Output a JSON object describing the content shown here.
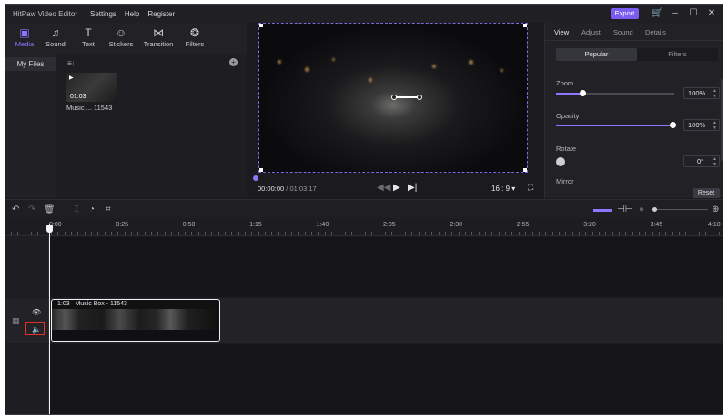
{
  "titlebar": {
    "app_name": "HitPaw Video Editor",
    "menus": [
      "Settings",
      "Help",
      "Register"
    ],
    "export_label": "Export"
  },
  "toolbar": {
    "tools": [
      {
        "label": "Media",
        "icon": "media-icon",
        "active": true
      },
      {
        "label": "Sound",
        "icon": "music-note-icon"
      },
      {
        "label": "Text",
        "icon": "text-icon"
      },
      {
        "label": "Stickers",
        "icon": "sticker-icon"
      },
      {
        "label": "Transition",
        "icon": "transition-icon"
      },
      {
        "label": "Filters",
        "icon": "filters-icon"
      }
    ]
  },
  "media": {
    "nav_item": "My Files",
    "item": {
      "duration": "01:03",
      "name": "Music ... 11543"
    }
  },
  "preview": {
    "current_time": "00:00:00",
    "separator": " / ",
    "total_time": "01:03:17",
    "aspect_ratio": "16 : 9"
  },
  "properties": {
    "tabs": [
      "View",
      "Adjust",
      "Sound",
      "Details"
    ],
    "segments": [
      "Popular",
      "Filters"
    ],
    "zoom": {
      "label": "Zoom",
      "value": "100%",
      "level": 0.22
    },
    "opacity": {
      "label": "Opacity",
      "value": "100%",
      "level": 1.0
    },
    "rotate": {
      "label": "Rotate",
      "value": "0°"
    },
    "mirror": {
      "label": "Mirror"
    },
    "reset_label": "Reset"
  },
  "timeline": {
    "ticks": [
      "0:00",
      "0:25",
      "0:50",
      "1:15",
      "1:40",
      "2:05",
      "2:30",
      "2:55",
      "3:20",
      "3:45",
      "4:10"
    ],
    "clip": {
      "duration": "1:03",
      "title": "Music Box - 11543"
    }
  },
  "colors": {
    "accent": "#7b5cf0",
    "highlight": "#e0302a",
    "background": "#1b1b1f"
  }
}
